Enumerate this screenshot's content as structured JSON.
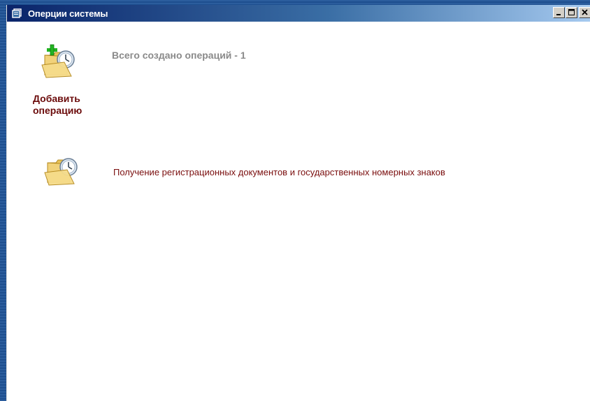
{
  "window": {
    "title": "Оперции системы"
  },
  "toolbar": {
    "add_label": "Добавить\nоперацию"
  },
  "summary": {
    "count_text": "Всего создано операций - 1"
  },
  "operations": [
    {
      "label": "Получение регистрационных документов и государственных номерных знаков"
    }
  ],
  "icons": {
    "title": "window-system-icon",
    "add": "folder-add-clock-icon",
    "operation": "folder-clock-icon"
  }
}
